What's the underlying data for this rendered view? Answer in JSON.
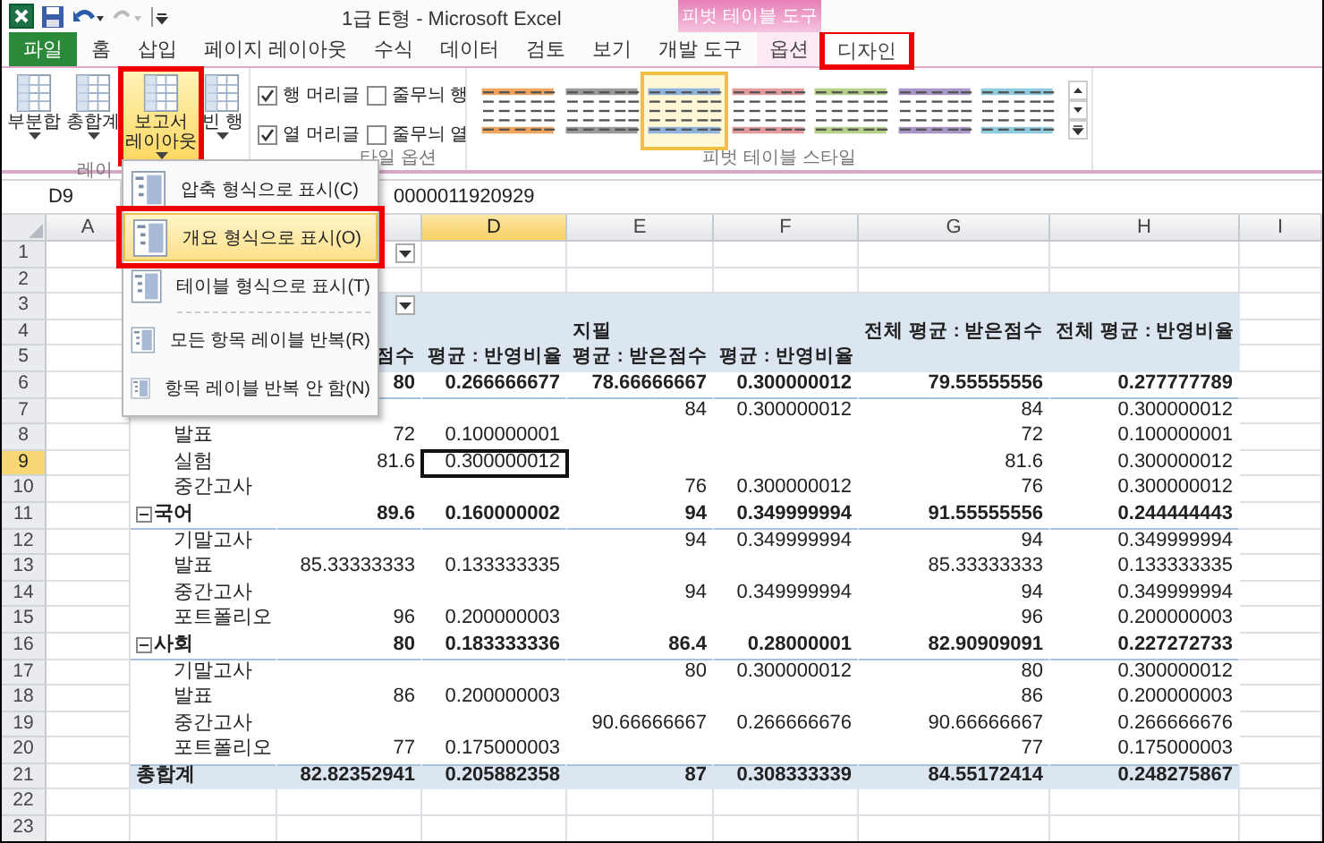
{
  "window": {
    "title": "1급 E형  -  Microsoft Excel",
    "context_label": "피벗 테이블 도구"
  },
  "tabs": [
    {
      "label": "파일",
      "kind": "file",
      "selected": false,
      "highlighted": false
    },
    {
      "label": "홈",
      "kind": "normal",
      "selected": false,
      "highlighted": false
    },
    {
      "label": "삽입",
      "kind": "normal",
      "selected": false,
      "highlighted": false
    },
    {
      "label": "페이지 레이아웃",
      "kind": "normal",
      "selected": false,
      "highlighted": false
    },
    {
      "label": "수식",
      "kind": "normal",
      "selected": false,
      "highlighted": false
    },
    {
      "label": "데이터",
      "kind": "normal",
      "selected": false,
      "highlighted": false
    },
    {
      "label": "검토",
      "kind": "normal",
      "selected": false,
      "highlighted": false
    },
    {
      "label": "보기",
      "kind": "normal",
      "selected": false,
      "highlighted": false
    },
    {
      "label": "개발 도구",
      "kind": "normal",
      "selected": false,
      "highlighted": false
    },
    {
      "label": "옵션",
      "kind": "context",
      "selected": false,
      "highlighted": false
    },
    {
      "label": "디자인",
      "kind": "context",
      "selected": true,
      "highlighted": true
    }
  ],
  "ribbon": {
    "layout_group": {
      "label": "레이",
      "buttons": [
        {
          "lines": [
            "부분합"
          ],
          "pressed": false,
          "highlighted": false
        },
        {
          "lines": [
            "총합계"
          ],
          "pressed": false,
          "highlighted": false
        },
        {
          "lines": [
            "보고서",
            "레이아웃"
          ],
          "pressed": true,
          "highlighted": true
        },
        {
          "lines": [
            "빈 행"
          ],
          "pressed": false,
          "highlighted": false
        }
      ]
    },
    "options_group": {
      "label": "타일 옵션",
      "checkboxes": [
        {
          "label": "행 머리글",
          "checked": true
        },
        {
          "label": "줄무늬 행",
          "checked": false
        },
        {
          "label": "열 머리글",
          "checked": true
        },
        {
          "label": "줄무늬 열",
          "checked": false
        }
      ]
    },
    "styles_group": {
      "label": "피벗 테이블 스타일",
      "styles": [
        {
          "color": "#f0a35c",
          "selected": false
        },
        {
          "color": "#9a9a9a",
          "selected": false
        },
        {
          "color": "#8fb3dc",
          "selected": true
        },
        {
          "color": "#e49a9a",
          "selected": false
        },
        {
          "color": "#b5cf86",
          "selected": false
        },
        {
          "color": "#a996c8",
          "selected": false
        },
        {
          "color": "#8ccbe0",
          "selected": false
        }
      ]
    }
  },
  "formula_bar": {
    "cell": "D9",
    "value": "0000011920929"
  },
  "menu": {
    "items": [
      {
        "label": "압축 형식으로 표시(C)",
        "selected": false,
        "highlighted": false,
        "separator_before": false
      },
      {
        "label": "개요 형식으로 표시(O)",
        "selected": true,
        "highlighted": true,
        "separator_before": false
      },
      {
        "label": "테이블 형식으로 표시(T)",
        "selected": false,
        "highlighted": false,
        "separator_before": false
      },
      {
        "label": "모든 항목 레이블 반복(R)",
        "selected": false,
        "highlighted": false,
        "separator_before": true
      },
      {
        "label": "항목 레이블 반복 안 함(N)",
        "selected": false,
        "highlighted": false,
        "separator_before": false
      }
    ]
  },
  "sheet": {
    "columns": [
      {
        "label": "A",
        "selected": false
      },
      {},
      {},
      {
        "label": "D",
        "selected": true
      },
      {
        "label": "E",
        "selected": false
      },
      {
        "label": "F",
        "selected": false
      },
      {
        "label": "G",
        "selected": false
      },
      {
        "label": "H",
        "selected": false
      },
      {
        "label": "I",
        "selected": false
      }
    ],
    "rows": [
      {
        "n": "1",
        "kind": "blank",
        "filter": true,
        "selected": false
      },
      {
        "n": "2",
        "kind": "blank",
        "selected": false
      },
      {
        "n": "3",
        "kind": "header",
        "filter": true,
        "selected": false
      },
      {
        "n": "4",
        "kind": "header",
        "e": "지필",
        "g": "전체 평균 : 받은점수",
        "h": "전체 평균 : 반영비율",
        "selected": false
      },
      {
        "n": "5",
        "kind": "header",
        "c": "점수",
        "d": "평균 : 반영비율",
        "e": "평균 : 받은점수",
        "f": "평균 : 반영비율",
        "selected": false
      },
      {
        "n": "6",
        "kind": "group",
        "c": "80",
        "d": "0.266666677",
        "e": "78.66666667",
        "f": "0.300000012",
        "g": "79.55555556",
        "h": "0.277777789",
        "selected": false
      },
      {
        "n": "7",
        "kind": "item",
        "e": "84",
        "f": "0.300000012",
        "g": "84",
        "h": "0.300000012",
        "selected": false
      },
      {
        "n": "8",
        "kind": "item",
        "b": "발표",
        "c": "72",
        "d": "0.100000001",
        "g": "72",
        "h": "0.100000001",
        "selected": false
      },
      {
        "n": "9",
        "kind": "item",
        "b": "실험",
        "c": "81.6",
        "d": "0.300000012",
        "g": "81.6",
        "h": "0.300000012",
        "selected": true
      },
      {
        "n": "10",
        "kind": "item",
        "b": "중간고사",
        "e": "76",
        "f": "0.300000012",
        "g": "76",
        "h": "0.300000012",
        "selected": false
      },
      {
        "n": "11",
        "kind": "group",
        "expanded": true,
        "b": "국어",
        "c": "89.6",
        "d": "0.160000002",
        "e": "94",
        "f": "0.349999994",
        "g": "91.55555556",
        "h": "0.244444443",
        "selected": false
      },
      {
        "n": "12",
        "kind": "item",
        "b": "기말고사",
        "e": "94",
        "f": "0.349999994",
        "g": "94",
        "h": "0.349999994",
        "selected": false
      },
      {
        "n": "13",
        "kind": "item",
        "b": "발표",
        "c": "85.33333333",
        "d": "0.133333335",
        "g": "85.33333333",
        "h": "0.133333335",
        "selected": false
      },
      {
        "n": "14",
        "kind": "item",
        "b": "중간고사",
        "e": "94",
        "f": "0.349999994",
        "g": "94",
        "h": "0.349999994",
        "selected": false
      },
      {
        "n": "15",
        "kind": "item",
        "b": "포트폴리오",
        "c": "96",
        "d": "0.200000003",
        "g": "96",
        "h": "0.200000003",
        "selected": false
      },
      {
        "n": "16",
        "kind": "group",
        "expanded": true,
        "b": "사회",
        "c": "80",
        "d": "0.183333336",
        "e": "86.4",
        "f": "0.28000001",
        "g": "82.90909091",
        "h": "0.227272733",
        "selected": false
      },
      {
        "n": "17",
        "kind": "item",
        "b": "기말고사",
        "e": "80",
        "f": "0.300000012",
        "g": "80",
        "h": "0.300000012",
        "selected": false
      },
      {
        "n": "18",
        "kind": "item",
        "b": "발표",
        "c": "86",
        "d": "0.200000003",
        "g": "86",
        "h": "0.200000003",
        "selected": false
      },
      {
        "n": "19",
        "kind": "item",
        "b": "중간고사",
        "e": "90.66666667",
        "f": "0.266666676",
        "g": "90.66666667",
        "h": "0.266666676",
        "selected": false
      },
      {
        "n": "20",
        "kind": "item",
        "b": "포트폴리오",
        "c": "77",
        "d": "0.175000003",
        "g": "77",
        "h": "0.175000003",
        "selected": false
      },
      {
        "n": "21",
        "kind": "total",
        "b": "총합계",
        "c": "82.82352941",
        "d": "0.205882358",
        "e": "87",
        "f": "0.308333339",
        "g": "84.55172414",
        "h": "0.248275867",
        "selected": false
      },
      {
        "n": "22",
        "kind": "blank",
        "selected": false
      },
      {
        "n": "23",
        "kind": "blank",
        "selected": false
      }
    ]
  }
}
